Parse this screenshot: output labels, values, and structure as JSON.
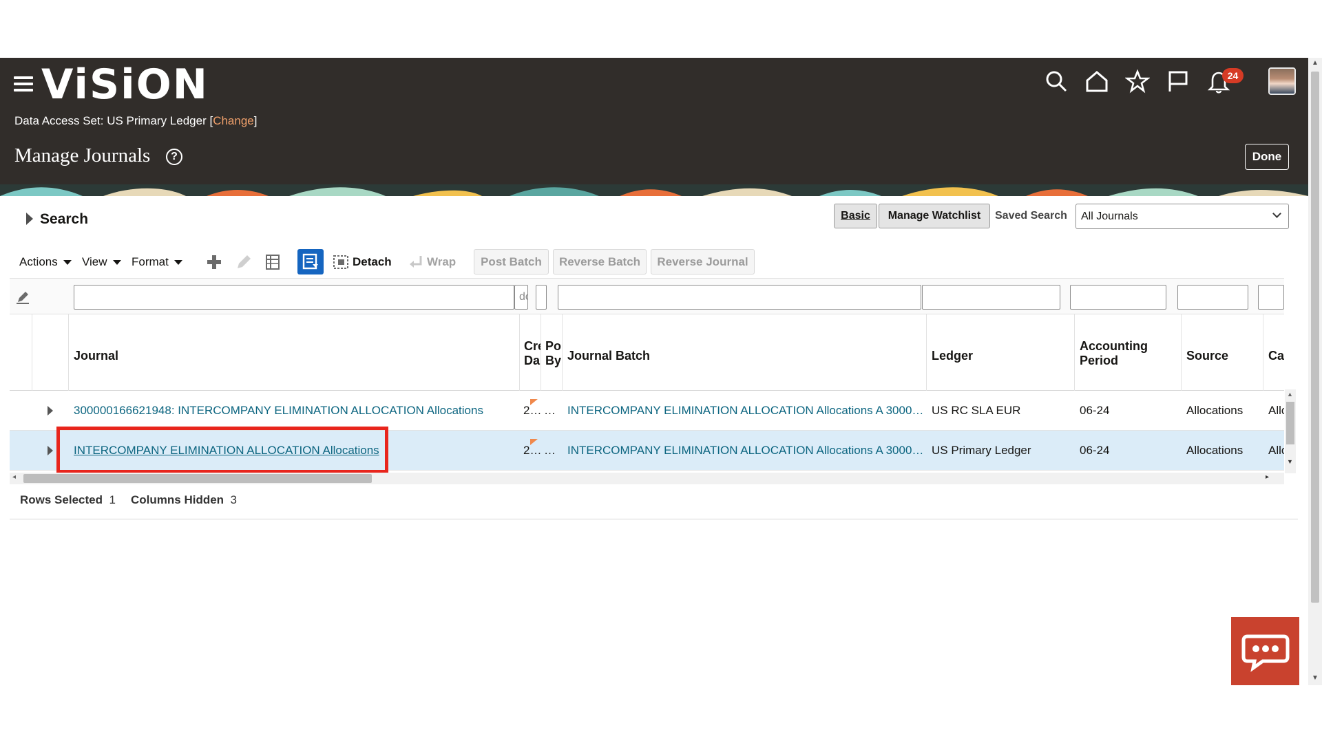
{
  "app": {
    "logo": "ViSiON",
    "data_access_label": "Data Access Set:",
    "data_access_value": "US Primary Ledger",
    "change_link": "Change",
    "page_title": "Manage Journals",
    "done_label": "Done",
    "notification_count": "24",
    "accent_color": "#312d2a"
  },
  "header_icons": [
    "search-icon",
    "home-icon",
    "star-icon",
    "flag-icon",
    "bell-icon"
  ],
  "search": {
    "toggle_label": "Search",
    "basic_label": "Basic",
    "manage_watchlist_label": "Manage Watchlist",
    "saved_search_label": "Saved Search",
    "saved_search_value": "All Journals"
  },
  "toolbar": {
    "actions": "Actions",
    "view": "View",
    "format": "Format",
    "detach": "Detach",
    "wrap": "Wrap",
    "post_batch": "Post Batch",
    "reverse_batch": "Reverse Batch",
    "reverse_journal": "Reverse Journal"
  },
  "table": {
    "filter_values": {
      "created_date": "dc"
    },
    "columns": {
      "journal": "Journal",
      "created_date_1": "Cre",
      "created_date_2": "Da",
      "posted_by_1": "Po",
      "posted_by_2": "By",
      "journal_batch": "Journal Batch",
      "ledger": "Ledger",
      "accounting_period_1": "Accounting",
      "accounting_period_2": "Period",
      "source": "Source",
      "category": "Cate"
    },
    "rows": [
      {
        "journal": "300000166621948: INTERCOMPANY ELIMINATION ALLOCATION Allocations",
        "created_date": "2…",
        "posted_by": "…",
        "journal_batch": "INTERCOMPANY ELIMINATION ALLOCATION Allocations A 30000…",
        "ledger": "US RC SLA EUR",
        "period": "06-24",
        "source": "Allocations",
        "category": "Alloc"
      },
      {
        "journal": "INTERCOMPANY ELIMINATION ALLOCATION Allocations",
        "created_date": "2…",
        "posted_by": "…",
        "journal_batch": "INTERCOMPANY ELIMINATION ALLOCATION Allocations A 30000…",
        "ledger": "US Primary Ledger",
        "period": "06-24",
        "source": "Allocations",
        "category": "Alloc"
      }
    ],
    "status": {
      "rows_selected_label": "Rows Selected",
      "rows_selected_value": "1",
      "columns_hidden_label": "Columns Hidden",
      "columns_hidden_value": "3"
    }
  }
}
